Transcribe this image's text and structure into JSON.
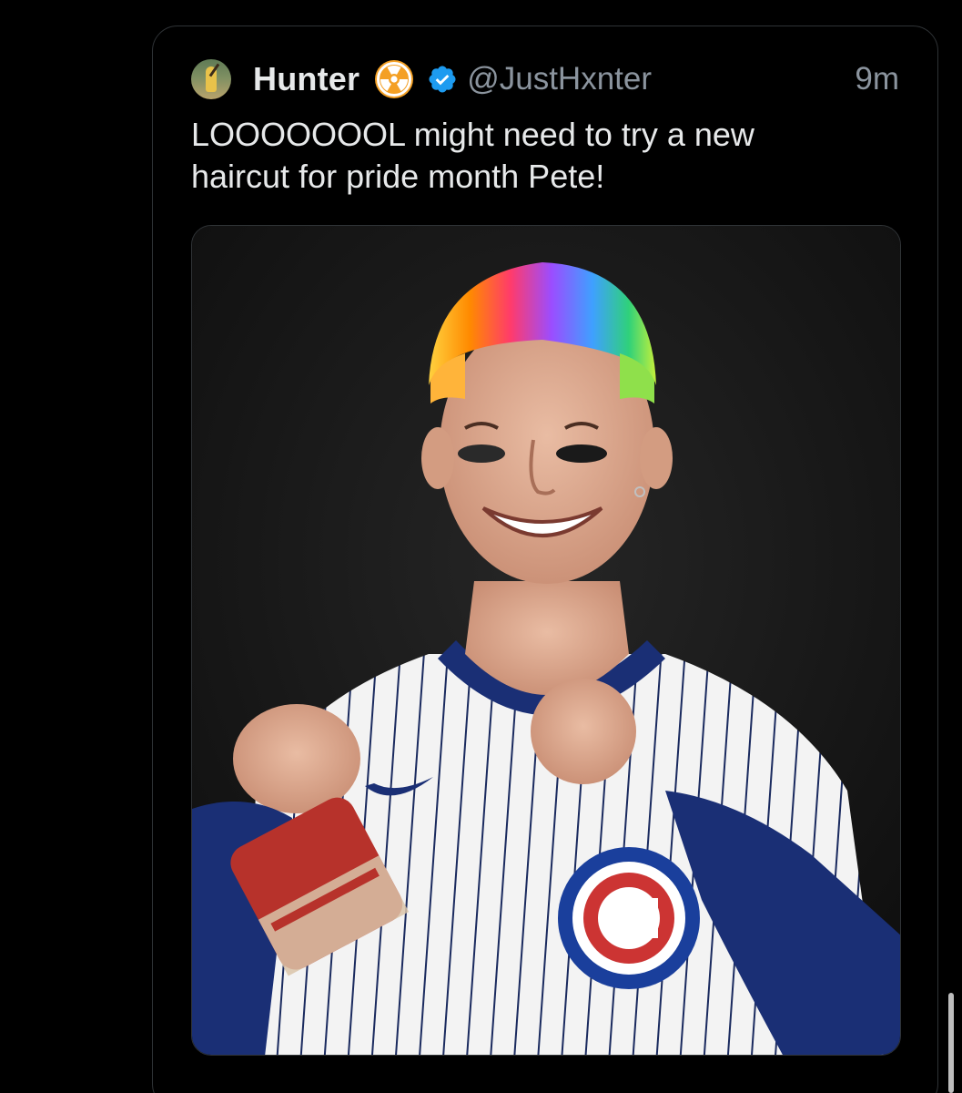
{
  "tweet": {
    "author": {
      "display_name": "Hunter",
      "handle": "@JustHxnter",
      "avatar_icon": "baseball-player-avatar",
      "badge_icon": "radioactive-icon",
      "verified_icon": "verified-badge-icon"
    },
    "timestamp": "9m",
    "text": "LOOOOOOOL might need to try a new\nhaircut for pride month Pete!",
    "media": {
      "type": "photo",
      "icon_name": "edited-baseball-player-photo"
    }
  },
  "colors": {
    "background": "#000000",
    "text_primary": "#e7e9ea",
    "text_secondary": "#8b949e",
    "verified_blue": "#1d9bf0",
    "badge_orange": "#f4a024",
    "card_border": "#2f3336"
  }
}
